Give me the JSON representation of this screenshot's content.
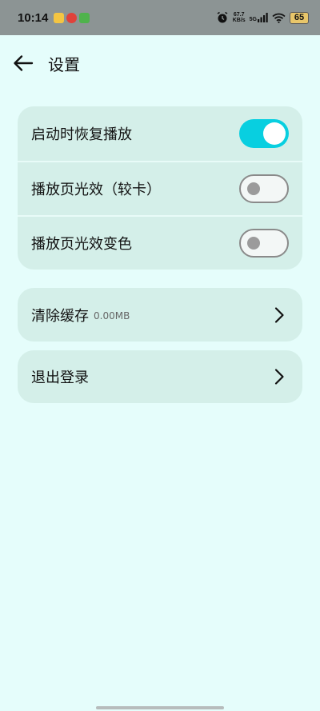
{
  "status_bar": {
    "time": "10:14",
    "net_speed_value": "67.7",
    "net_speed_unit": "KB/s",
    "network_type": "5G",
    "battery": "65"
  },
  "header": {
    "title": "设置",
    "back_icon": "arrow-left-icon"
  },
  "settings": {
    "items": [
      {
        "label": "启动时恢复播放",
        "toggle": true
      },
      {
        "label": "播放页光效（较卡）",
        "toggle": false
      },
      {
        "label": "播放页光效变色",
        "toggle": false
      }
    ]
  },
  "cache": {
    "label": "清除缓存",
    "size": "0.00MB",
    "icon": "chevron-right-icon"
  },
  "logout": {
    "label": "退出登录",
    "icon": "chevron-right-icon"
  },
  "colors": {
    "background": "#e5fdfb",
    "card": "#d4efe9",
    "accent": "#08cfe0",
    "status_bar": "#8c9494"
  }
}
